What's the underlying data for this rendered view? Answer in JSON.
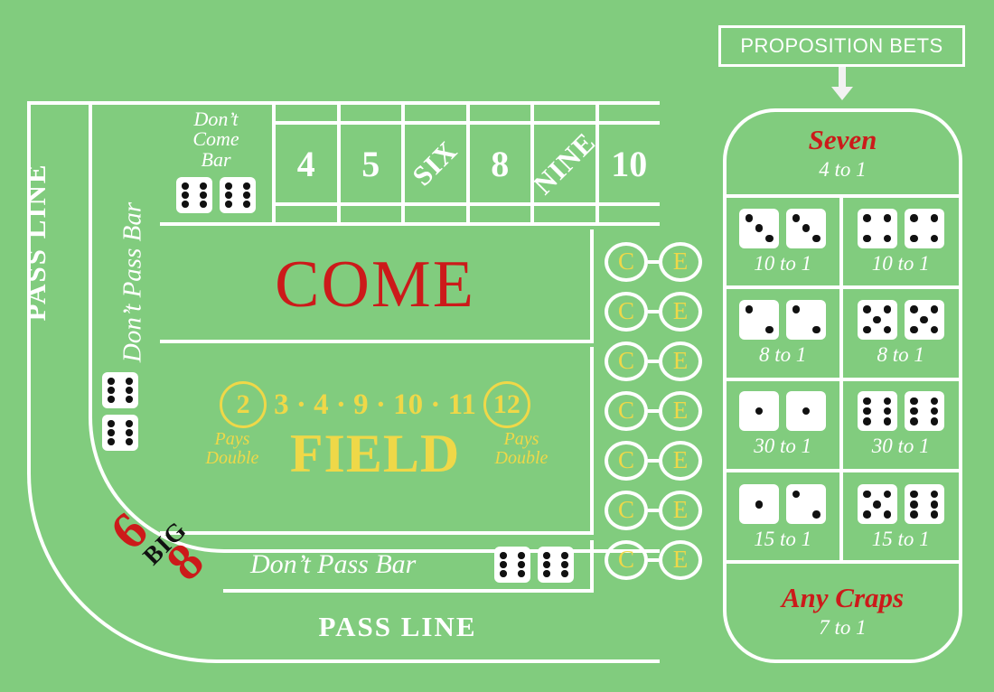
{
  "table": {
    "background_color": "#81cc7e",
    "line_color": "#ffffff",
    "red": "#cc1a1a",
    "yellow": "#efd848",
    "black": "#111111"
  },
  "pass_line": {
    "left_label": "PASS LINE",
    "bottom_label": "PASS LINE"
  },
  "dont_pass_bar": {
    "vertical_label": "Don’t Pass Bar",
    "bottom_label": "Don’t Pass Bar",
    "bar_dice": [
      6,
      6
    ]
  },
  "dont_come_bar": {
    "label_line1": "Don’t",
    "label_line2": "Come",
    "label_line3": "Bar",
    "bar_dice": [
      6,
      6
    ]
  },
  "number_boxes": [
    {
      "label": "4",
      "diagonal": false
    },
    {
      "label": "5",
      "diagonal": false
    },
    {
      "label": "SIX",
      "diagonal": true
    },
    {
      "label": "8",
      "diagonal": false
    },
    {
      "label": "NINE",
      "diagonal": true
    },
    {
      "label": "10",
      "diagonal": false
    }
  ],
  "come": {
    "label": "COME"
  },
  "field": {
    "word": "FIELD",
    "circled_low": "2",
    "circled_high": "12",
    "middle_numbers": "3 · 4 · 9 · 10 · 11",
    "pays_left_line1": "Pays",
    "pays_left_line2": "Double",
    "pays_right_line1": "Pays",
    "pays_right_line2": "Double"
  },
  "big_six_eight": {
    "six": "6",
    "eight": "8",
    "big": "BIG"
  },
  "ce_bets": {
    "c_label": "C",
    "e_label": "E",
    "rows": 7
  },
  "proposition": {
    "header": "PROPOSITION BETS",
    "top_bet": {
      "name": "Seven",
      "odds": "4 to 1"
    },
    "bottom_bet": {
      "name": "Any Craps",
      "odds": "7 to 1"
    },
    "cells": [
      {
        "dice": [
          3,
          3
        ],
        "odds": "10 to 1"
      },
      {
        "dice": [
          4,
          4
        ],
        "odds": "10 to 1"
      },
      {
        "dice": [
          2,
          2
        ],
        "odds": "8 to 1"
      },
      {
        "dice": [
          5,
          5
        ],
        "odds": "8 to 1"
      },
      {
        "dice": [
          1,
          1
        ],
        "odds": "30 to 1"
      },
      {
        "dice": [
          6,
          6
        ],
        "odds": "30 to 1"
      },
      {
        "dice": [
          1,
          2
        ],
        "odds": "15 to 1"
      },
      {
        "dice": [
          5,
          6
        ],
        "odds": "15 to 1"
      }
    ]
  },
  "icons": {
    "down_arrow": "down-arrow-icon",
    "die": "die-icon"
  }
}
